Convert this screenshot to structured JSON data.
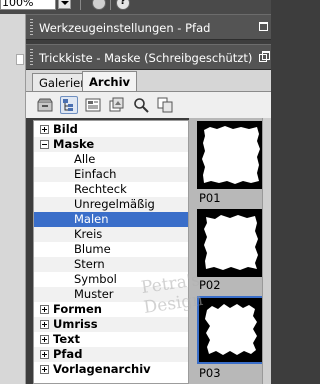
{
  "toolbar_top": {
    "zoom_value": "100%"
  },
  "panels": {
    "tool_options": {
      "title": "Werkzeugeinstellungen - Pfad"
    },
    "palette": {
      "title": "Trickkiste - Maske (Schreibgeschützt)"
    }
  },
  "tabs": [
    {
      "label": "Galerien",
      "active": false
    },
    {
      "label": "Archiv",
      "active": true
    }
  ],
  "archive_toolbar": {
    "icons": [
      "archive-box-icon",
      "tree-view-icon",
      "list-view-icon",
      "thumbnail-view-icon",
      "search-icon",
      "copy-icon"
    ]
  },
  "tree": {
    "items": [
      {
        "label": "Bild",
        "level": 0,
        "expanded": false
      },
      {
        "label": "Maske",
        "level": 0,
        "expanded": true
      },
      {
        "label": "Alle",
        "level": 1
      },
      {
        "label": "Einfach",
        "level": 1
      },
      {
        "label": "Rechteck",
        "level": 1
      },
      {
        "label": "Unregelmäßig",
        "level": 1
      },
      {
        "label": "Malen",
        "level": 1,
        "selected": true
      },
      {
        "label": "Kreis",
        "level": 1
      },
      {
        "label": "Blume",
        "level": 1
      },
      {
        "label": "Stern",
        "level": 1
      },
      {
        "label": "Symbol",
        "level": 1
      },
      {
        "label": "Muster",
        "level": 1
      },
      {
        "label": "Formen",
        "level": 0,
        "expanded": false
      },
      {
        "label": "Umriss",
        "level": 0,
        "expanded": false
      },
      {
        "label": "Text",
        "level": 0,
        "expanded": false
      },
      {
        "label": "Pfad",
        "level": 0,
        "expanded": false
      },
      {
        "label": "Vorlagenarchiv",
        "level": 0,
        "expanded": false
      }
    ]
  },
  "thumbnails": [
    {
      "caption": "P01",
      "selected": false
    },
    {
      "caption": "P02",
      "selected": false
    },
    {
      "caption": "P03",
      "selected": true
    }
  ],
  "watermark": {
    "line1": "Petra's",
    "line2": "Design"
  },
  "colors": {
    "selection": "#3a6ec9",
    "header": "#545454",
    "panel": "#d6d6d6"
  }
}
